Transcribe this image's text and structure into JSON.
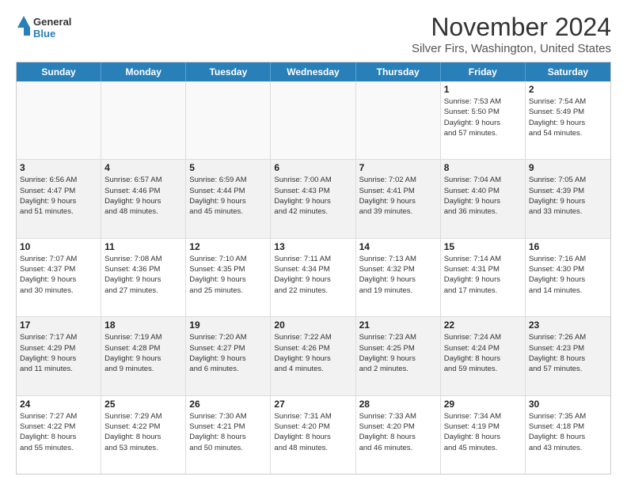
{
  "logo": {
    "general": "General",
    "blue": "Blue"
  },
  "title": "November 2024",
  "location": "Silver Firs, Washington, United States",
  "days": [
    "Sunday",
    "Monday",
    "Tuesday",
    "Wednesday",
    "Thursday",
    "Friday",
    "Saturday"
  ],
  "weeks": [
    [
      {
        "day": "",
        "lines": []
      },
      {
        "day": "",
        "lines": []
      },
      {
        "day": "",
        "lines": []
      },
      {
        "day": "",
        "lines": []
      },
      {
        "day": "",
        "lines": []
      },
      {
        "day": "1",
        "lines": [
          "Sunrise: 7:53 AM",
          "Sunset: 5:50 PM",
          "Daylight: 9 hours",
          "and 57 minutes."
        ]
      },
      {
        "day": "2",
        "lines": [
          "Sunrise: 7:54 AM",
          "Sunset: 5:49 PM",
          "Daylight: 9 hours",
          "and 54 minutes."
        ]
      }
    ],
    [
      {
        "day": "3",
        "lines": [
          "Sunrise: 6:56 AM",
          "Sunset: 4:47 PM",
          "Daylight: 9 hours",
          "and 51 minutes."
        ]
      },
      {
        "day": "4",
        "lines": [
          "Sunrise: 6:57 AM",
          "Sunset: 4:46 PM",
          "Daylight: 9 hours",
          "and 48 minutes."
        ]
      },
      {
        "day": "5",
        "lines": [
          "Sunrise: 6:59 AM",
          "Sunset: 4:44 PM",
          "Daylight: 9 hours",
          "and 45 minutes."
        ]
      },
      {
        "day": "6",
        "lines": [
          "Sunrise: 7:00 AM",
          "Sunset: 4:43 PM",
          "Daylight: 9 hours",
          "and 42 minutes."
        ]
      },
      {
        "day": "7",
        "lines": [
          "Sunrise: 7:02 AM",
          "Sunset: 4:41 PM",
          "Daylight: 9 hours",
          "and 39 minutes."
        ]
      },
      {
        "day": "8",
        "lines": [
          "Sunrise: 7:04 AM",
          "Sunset: 4:40 PM",
          "Daylight: 9 hours",
          "and 36 minutes."
        ]
      },
      {
        "day": "9",
        "lines": [
          "Sunrise: 7:05 AM",
          "Sunset: 4:39 PM",
          "Daylight: 9 hours",
          "and 33 minutes."
        ]
      }
    ],
    [
      {
        "day": "10",
        "lines": [
          "Sunrise: 7:07 AM",
          "Sunset: 4:37 PM",
          "Daylight: 9 hours",
          "and 30 minutes."
        ]
      },
      {
        "day": "11",
        "lines": [
          "Sunrise: 7:08 AM",
          "Sunset: 4:36 PM",
          "Daylight: 9 hours",
          "and 27 minutes."
        ]
      },
      {
        "day": "12",
        "lines": [
          "Sunrise: 7:10 AM",
          "Sunset: 4:35 PM",
          "Daylight: 9 hours",
          "and 25 minutes."
        ]
      },
      {
        "day": "13",
        "lines": [
          "Sunrise: 7:11 AM",
          "Sunset: 4:34 PM",
          "Daylight: 9 hours",
          "and 22 minutes."
        ]
      },
      {
        "day": "14",
        "lines": [
          "Sunrise: 7:13 AM",
          "Sunset: 4:32 PM",
          "Daylight: 9 hours",
          "and 19 minutes."
        ]
      },
      {
        "day": "15",
        "lines": [
          "Sunrise: 7:14 AM",
          "Sunset: 4:31 PM",
          "Daylight: 9 hours",
          "and 17 minutes."
        ]
      },
      {
        "day": "16",
        "lines": [
          "Sunrise: 7:16 AM",
          "Sunset: 4:30 PM",
          "Daylight: 9 hours",
          "and 14 minutes."
        ]
      }
    ],
    [
      {
        "day": "17",
        "lines": [
          "Sunrise: 7:17 AM",
          "Sunset: 4:29 PM",
          "Daylight: 9 hours",
          "and 11 minutes."
        ]
      },
      {
        "day": "18",
        "lines": [
          "Sunrise: 7:19 AM",
          "Sunset: 4:28 PM",
          "Daylight: 9 hours",
          "and 9 minutes."
        ]
      },
      {
        "day": "19",
        "lines": [
          "Sunrise: 7:20 AM",
          "Sunset: 4:27 PM",
          "Daylight: 9 hours",
          "and 6 minutes."
        ]
      },
      {
        "day": "20",
        "lines": [
          "Sunrise: 7:22 AM",
          "Sunset: 4:26 PM",
          "Daylight: 9 hours",
          "and 4 minutes."
        ]
      },
      {
        "day": "21",
        "lines": [
          "Sunrise: 7:23 AM",
          "Sunset: 4:25 PM",
          "Daylight: 9 hours",
          "and 2 minutes."
        ]
      },
      {
        "day": "22",
        "lines": [
          "Sunrise: 7:24 AM",
          "Sunset: 4:24 PM",
          "Daylight: 8 hours",
          "and 59 minutes."
        ]
      },
      {
        "day": "23",
        "lines": [
          "Sunrise: 7:26 AM",
          "Sunset: 4:23 PM",
          "Daylight: 8 hours",
          "and 57 minutes."
        ]
      }
    ],
    [
      {
        "day": "24",
        "lines": [
          "Sunrise: 7:27 AM",
          "Sunset: 4:22 PM",
          "Daylight: 8 hours",
          "and 55 minutes."
        ]
      },
      {
        "day": "25",
        "lines": [
          "Sunrise: 7:29 AM",
          "Sunset: 4:22 PM",
          "Daylight: 8 hours",
          "and 53 minutes."
        ]
      },
      {
        "day": "26",
        "lines": [
          "Sunrise: 7:30 AM",
          "Sunset: 4:21 PM",
          "Daylight: 8 hours",
          "and 50 minutes."
        ]
      },
      {
        "day": "27",
        "lines": [
          "Sunrise: 7:31 AM",
          "Sunset: 4:20 PM",
          "Daylight: 8 hours",
          "and 48 minutes."
        ]
      },
      {
        "day": "28",
        "lines": [
          "Sunrise: 7:33 AM",
          "Sunset: 4:20 PM",
          "Daylight: 8 hours",
          "and 46 minutes."
        ]
      },
      {
        "day": "29",
        "lines": [
          "Sunrise: 7:34 AM",
          "Sunset: 4:19 PM",
          "Daylight: 8 hours",
          "and 45 minutes."
        ]
      },
      {
        "day": "30",
        "lines": [
          "Sunrise: 7:35 AM",
          "Sunset: 4:18 PM",
          "Daylight: 8 hours",
          "and 43 minutes."
        ]
      }
    ]
  ]
}
